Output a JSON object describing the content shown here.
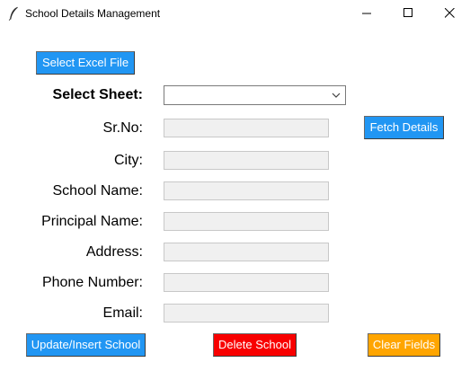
{
  "window": {
    "title": "School Details Management",
    "controls": [
      "minimize-icon",
      "maximize-icon",
      "close-icon"
    ]
  },
  "buttons": {
    "select_excel": "Select Excel File",
    "fetch_details": "Fetch Details",
    "update_insert": "Update/Insert School",
    "delete": "Delete School",
    "clear": "Clear Fields"
  },
  "sheet": {
    "label": "Select Sheet:",
    "value": ""
  },
  "fields": [
    {
      "label": "Sr.No:",
      "value": ""
    },
    {
      "label": "City:",
      "value": ""
    },
    {
      "label": "School Name:",
      "value": ""
    },
    {
      "label": "Principal Name:",
      "value": ""
    },
    {
      "label": "Address:",
      "value": ""
    },
    {
      "label": "Phone Number:",
      "value": ""
    },
    {
      "label": "Email:",
      "value": ""
    }
  ],
  "colors": {
    "primary_button": "#2196f3",
    "delete_button": "#f80000",
    "clear_button": "#ffa500",
    "entry_background": "#f0f0f0"
  }
}
